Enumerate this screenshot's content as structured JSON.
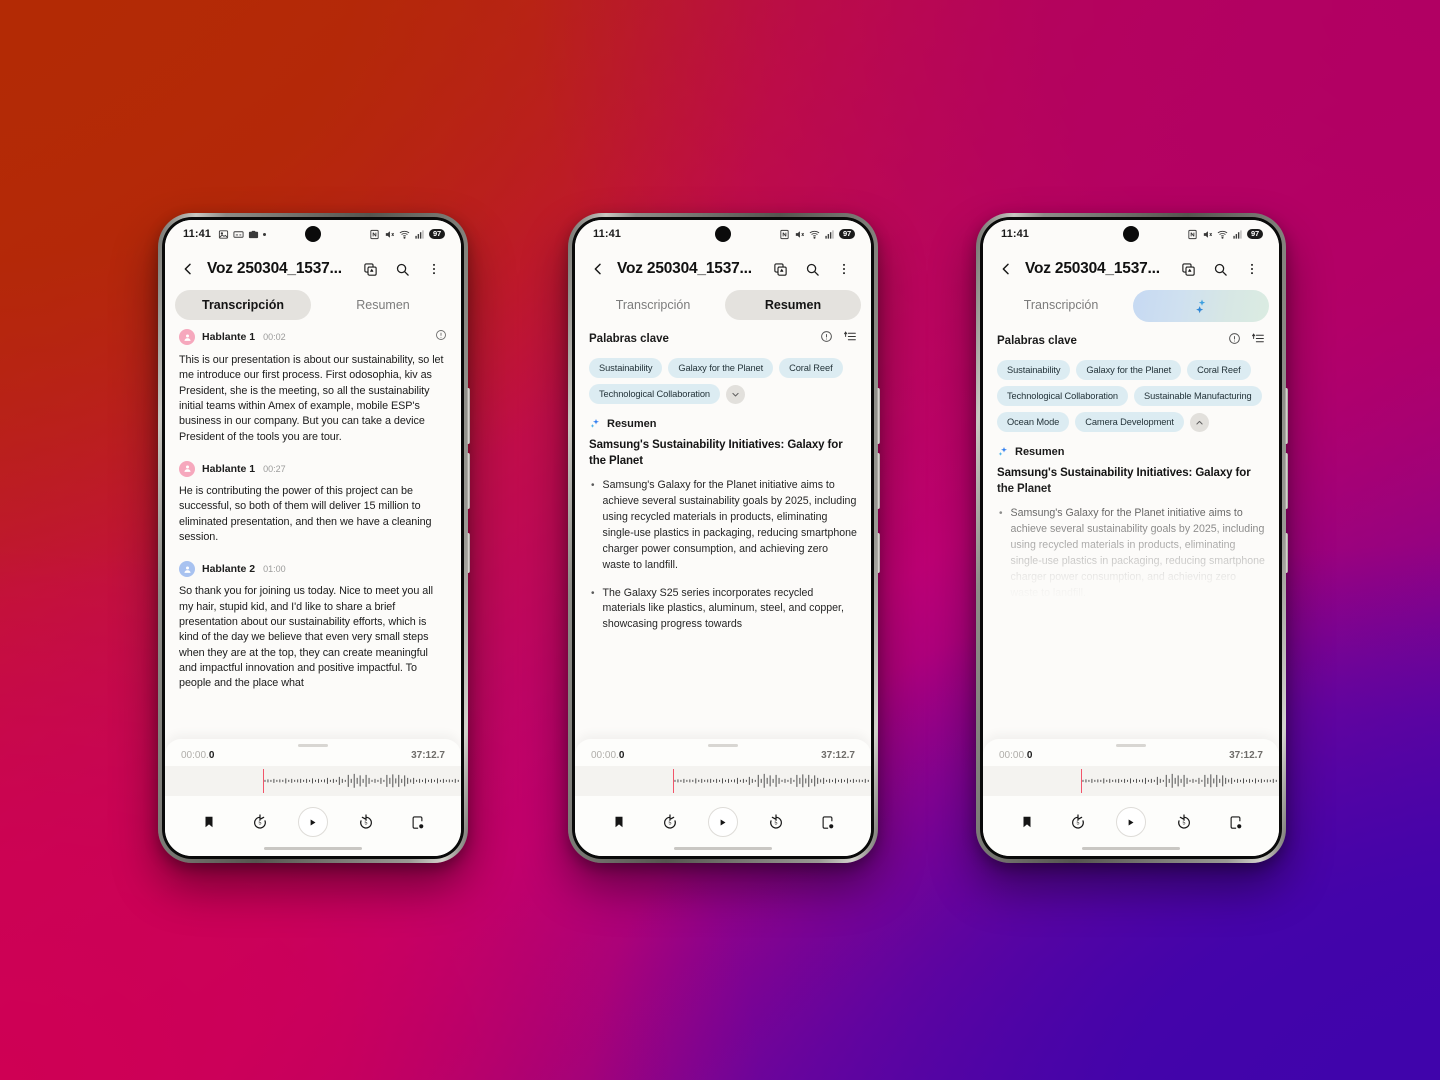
{
  "background": {
    "top_left": "#b32a05",
    "top_right": "#b00063",
    "bottom_left": "#cc0052",
    "bottom_right": "#4004ab"
  },
  "status_bar": {
    "time": "11:41",
    "battery": "97",
    "left_icons": [
      "gallery-icon",
      "subtitle-icon",
      "camera-icon",
      "dot-icon"
    ],
    "right_icons": [
      "nfc-icon",
      "mute-icon",
      "wifi-icon",
      "signal-icon"
    ]
  },
  "app_bar": {
    "title": "Voz 250304_1537...",
    "back_icon": "chevron-left-icon",
    "translate_icon": "translate-pages-icon",
    "search_icon": "search-icon",
    "more_icon": "more-vertical-icon"
  },
  "tabs": {
    "transcription": "Transcripción",
    "summary": "Resumen",
    "ai_icon": "ai-sparkle-icon"
  },
  "transcription": {
    "entries": [
      {
        "speaker": "Hablante 1",
        "time": "00:02",
        "avatar": "person-icon",
        "color": "pink",
        "text": "This is our presentation is about our sustainability, so let me introduce our first process. First odosophia, kiv as President, she is the meeting, so all the sustainability initial teams within Amex of example, mobile ESP's business in our company. But you can take a device President of the tools you are tour."
      },
      {
        "speaker": "Hablante 1",
        "time": "00:27",
        "avatar": "person-icon",
        "color": "pink",
        "text": "He is contributing the power of this project can be successful, so both of them will deliver 15 million to eliminated presentation, and then we have a cleaning session."
      },
      {
        "speaker": "Hablante 2",
        "time": "01:00",
        "avatar": "person-icon",
        "color": "blue",
        "text": "So thank you for joining us today. Nice to meet you all my hair, stupid kid, and I'd like to share a brief presentation about our sustainability efforts, which is kind of the day we believe that even very small steps when they are at the top, they can create meaningful and impactful innovation and positive impactful. To people and the place what"
      }
    ]
  },
  "summary": {
    "keywords_label": "Palabras clave",
    "info_icon": "info-circle-icon",
    "sort_icon": "sort-list-icon",
    "keywords_collapsed": [
      "Sustainability",
      "Galaxy for the Planet",
      "Coral Reef",
      "Technological Collaboration"
    ],
    "keywords_expanded": [
      "Sustainability",
      "Galaxy for the Planet",
      "Coral Reef",
      "Technological Collaboration",
      "Sustainable Manufacturing",
      "Ocean Mode",
      "Camera Development"
    ],
    "expand_icon": "chevron-down-icon",
    "collapse_icon": "chevron-up-icon",
    "resumen_label": "Resumen",
    "resumen_icon": "ai-sparkle-icon",
    "heading": "Samsung's Sustainability Initiatives: Galaxy for the Planet",
    "bullets": [
      "Samsung's Galaxy for the Planet initiative aims to achieve several sustainability goals by 2025, including using recycled materials in products, eliminating single-use plastics in packaging, reducing smartphone charger power consumption, and achieving zero waste to landfill.",
      "The Galaxy S25 series incorporates recycled materials like plastics, aluminum, steel, and copper, showcasing progress towards"
    ]
  },
  "player": {
    "current_time_prefix": "00:00.",
    "current_time_decimal": "0",
    "total_time": "37:12.7",
    "controls": [
      {
        "name": "bookmark-button",
        "icon": "bookmark-icon"
      },
      {
        "name": "rewind-button",
        "icon": "rewind-5-icon"
      },
      {
        "name": "play-button",
        "icon": "play-icon"
      },
      {
        "name": "forward-button",
        "icon": "forward-5-icon"
      },
      {
        "name": "note-button",
        "icon": "add-note-icon"
      }
    ]
  }
}
